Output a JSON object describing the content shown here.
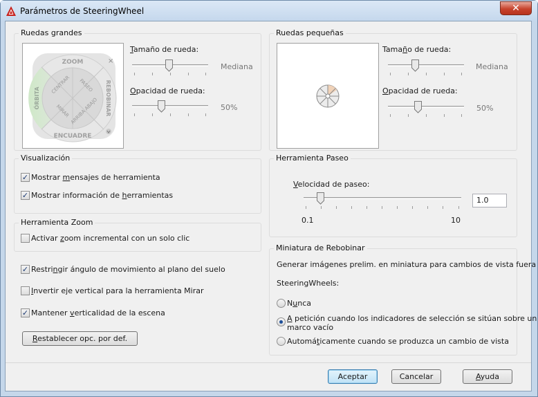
{
  "window": {
    "title": "Parámetros de SteeringWheel",
    "close_symbol": "✕"
  },
  "big_wheels": {
    "group_label": "Ruedas grandes",
    "wheel": {
      "zoom": "ZOOM",
      "orbita": "ÓRBITA",
      "rebobinar": "REBOBINAR",
      "encuadre": "ENCUADRE",
      "centrar": "CENTRAR",
      "paseo": "PASEO",
      "mirar": "MIRAR",
      "arriba_abajo": "ARRIBA ABAJO",
      "close_symbol": "×"
    },
    "size_label_u": "T",
    "size_label_rest": "amaño de rueda:",
    "size_value": "Mediana",
    "opacity_label_u": "O",
    "opacity_label_rest": "pacidad de rueda:",
    "opacity_value": "50%"
  },
  "small_wheels": {
    "group_label": "Ruedas pequeñas",
    "size_label_a": "Tama",
    "size_label_u": "ñ",
    "size_label_b": "o de rueda:",
    "size_value": "Mediana",
    "opacity_label_u": "O",
    "opacity_label_rest": "pacidad de rueda:",
    "opacity_value": "50%"
  },
  "display": {
    "group_label": "Visualización",
    "show_messages_a": "Mostrar ",
    "show_messages_u": "m",
    "show_messages_b": "ensajes de herramienta",
    "show_messages_checked": true,
    "show_tooltips_a": "Mostrar información de ",
    "show_tooltips_u": "h",
    "show_tooltips_b": "erramientas",
    "show_tooltips_checked": true
  },
  "zoom_tool": {
    "group_label": "Herramienta Zoom",
    "incremental_a": "Activar ",
    "incremental_u": "z",
    "incremental_b": "oom incremental con un solo clic",
    "incremental_checked": false
  },
  "options": {
    "restrict_a": "Restri",
    "restrict_u": "n",
    "restrict_b": "gir ángulo de movimiento al plano del suelo",
    "restrict_checked": true,
    "invert_u": "I",
    "invert_b": "nvertir eje vertical para la herramienta Mirar",
    "invert_checked": false,
    "upright_a": "Mantener ",
    "upright_u": "v",
    "upright_b": "erticalidad de la escena",
    "upright_checked": true,
    "reset_u": "R",
    "reset_b": "establecer opc. por def."
  },
  "walk_tool": {
    "group_label": "Herramienta Paseo",
    "speed_label_u": "V",
    "speed_label_rest": "elocidad de paseo:",
    "speed_value": "1.0",
    "speed_min": "0.1",
    "speed_max": "10"
  },
  "rewind": {
    "group_label": "Miniatura de Rebobinar",
    "desc_line1": "Generar imágenes prelim. en miniatura para cambios de vista fuera de",
    "desc_line2": "SteeringWheels:",
    "never_a": "N",
    "never_u": "u",
    "never_b": "nca",
    "on_demand_u": "A",
    "on_demand_line1": " petición cuando los indicadores de selección se sitúan sobre un",
    "on_demand_line2": "marco vacío",
    "auto_a": "Automá",
    "auto_u": "t",
    "auto_b": "icamente cuando se produzca un cambio de vista",
    "selected": "on_demand"
  },
  "footer": {
    "ok": "Aceptar",
    "cancel": "Cancelar",
    "help_u": "A",
    "help_rest": "yuda"
  },
  "colors": {
    "accent_selection": "#3c7fb1",
    "close_button": "#c7432d",
    "checkmark": "#1c3a73"
  }
}
